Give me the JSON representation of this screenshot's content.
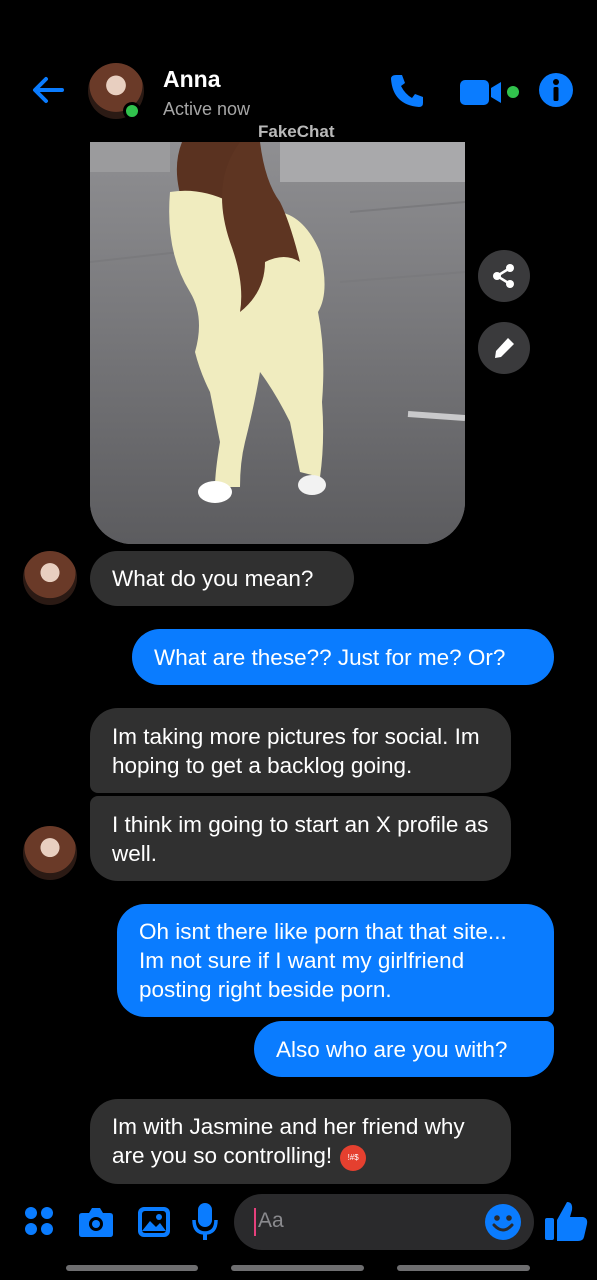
{
  "header": {
    "name": "Anna",
    "status": "Active now",
    "watermark": "FakeChat"
  },
  "colors": {
    "accent": "#0a7cff",
    "online": "#31c24d",
    "incoming_bubble": "#303030",
    "background": "#000000"
  },
  "icons": [
    "back-arrow-icon",
    "phone-icon",
    "video-camera-icon",
    "info-icon",
    "share-icon",
    "pencil-icon",
    "apps-grid-icon",
    "camera-icon",
    "gallery-icon",
    "microphone-icon",
    "emoji-icon",
    "thumbs-up-icon"
  ],
  "messages": [
    {
      "dir": "in",
      "text": "What do you mean?"
    },
    {
      "dir": "out",
      "text": "What are these?? Just for me? Or?"
    },
    {
      "dir": "in",
      "text": "Im taking more pictures for social. Im hoping to get a backlog going."
    },
    {
      "dir": "in",
      "text": "I think im going to start an X profile as well."
    },
    {
      "dir": "out",
      "text": "Oh isnt there like porn that that site... Im not sure if I want my girlfriend posting right beside porn."
    },
    {
      "dir": "out",
      "text": "Also who are you with?"
    },
    {
      "dir": "in",
      "text": "Im with Jasmine and her friend why are you so controlling!",
      "emoji": "angry-cursing-face"
    }
  ],
  "composer": {
    "placeholder": "Aa"
  }
}
